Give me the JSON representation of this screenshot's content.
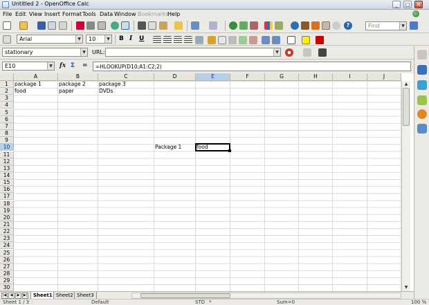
{
  "window": {
    "title": "Untitled 2 - OpenOffice Calc",
    "minimize": "_",
    "restore": "□",
    "close": "✕"
  },
  "menu": [
    "File",
    "Edit",
    "View",
    "Insert",
    "Format",
    "Tools",
    "Data",
    "Window",
    "Bookmarks",
    "Help"
  ],
  "menu_disabled": "Bookmarks",
  "toolbar": {
    "find_placeholder": "Find",
    "font_name": "Arial",
    "font_size": "10",
    "bold": "B",
    "italic": "I",
    "underline": "U"
  },
  "hyperlink_bar": {
    "name_value": "stationary",
    "url_label": "URL:",
    "url_value": ""
  },
  "formula_bar": {
    "cell_ref": "E10",
    "function_wizard": "fx",
    "sum": "Σ",
    "equals": "=",
    "formula": "=HLOOKUP(D10;A1:C2;2)"
  },
  "columns": [
    "A",
    "B",
    "C",
    "D",
    "E",
    "F",
    "G",
    "H",
    "I",
    "J"
  ],
  "selected_column": "E",
  "rows": [
    "1",
    "2",
    "3",
    "4",
    "5",
    "6",
    "7",
    "8",
    "9",
    "10",
    "11",
    "12",
    "13",
    "14",
    "15",
    "16",
    "17",
    "18",
    "19",
    "20",
    "21",
    "22",
    "23",
    "24",
    "25",
    "26",
    "27",
    "28",
    "29",
    "30"
  ],
  "selected_row": "10",
  "cells": {
    "A1": "package 1",
    "B1": "package 2",
    "C1": "package 3",
    "A2": "food",
    "B2": "paper",
    "C2": "DVDs",
    "D10": "Package 1",
    "E10": "food"
  },
  "sheets": [
    "Sheet1",
    "Sheet2",
    "Sheet3"
  ],
  "active_sheet": "Sheet1",
  "status": {
    "sheet": "Sheet 1 / 3",
    "style": "Default",
    "mode": "STD",
    "modified": "*",
    "sum": "Sum=0",
    "zoom": "100 %"
  }
}
